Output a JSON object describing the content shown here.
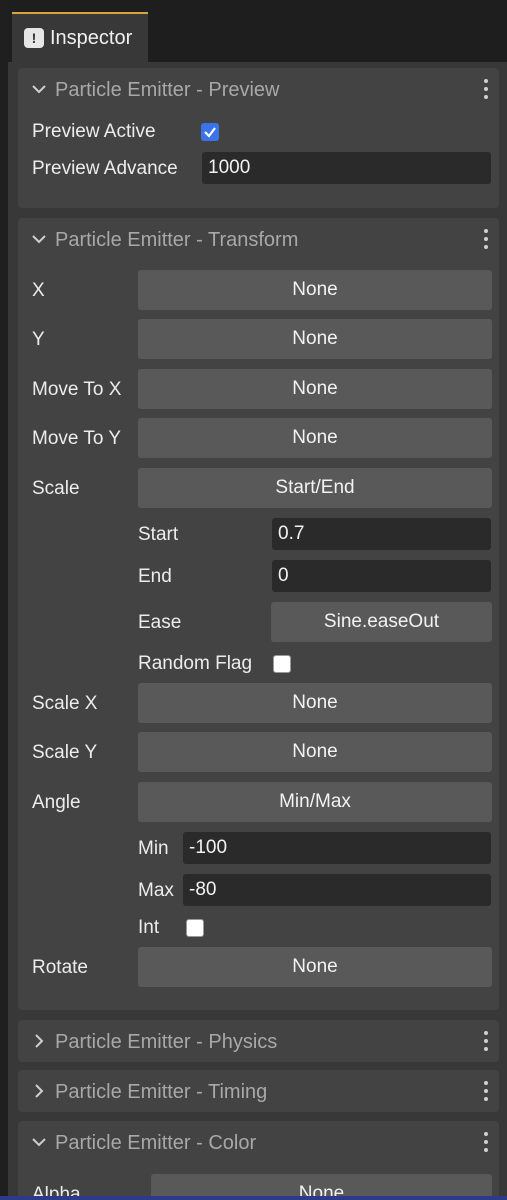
{
  "tab": {
    "icon": "info-bubble-icon",
    "label": "Inspector"
  },
  "preview": {
    "title": "Particle Emitter - Preview",
    "active_label": "Preview Active",
    "active_checked": true,
    "advance_label": "Preview Advance",
    "advance_value": "1000"
  },
  "transform": {
    "title": "Particle Emitter - Transform",
    "x": {
      "label": "X",
      "value": "None"
    },
    "y": {
      "label": "Y",
      "value": "None"
    },
    "move_to_x": {
      "label": "Move To X",
      "value": "None"
    },
    "move_to_y": {
      "label": "Move To Y",
      "value": "None"
    },
    "scale": {
      "label": "Scale",
      "value": "Start/End",
      "start_label": "Start",
      "start_value": "0.7",
      "end_label": "End",
      "end_value": "0",
      "ease_label": "Ease",
      "ease_value": "Sine.easeOut",
      "random_label": "Random Flag",
      "random_checked": false
    },
    "scale_x": {
      "label": "Scale X",
      "value": "None"
    },
    "scale_y": {
      "label": "Scale Y",
      "value": "None"
    },
    "angle": {
      "label": "Angle",
      "value": "Min/Max",
      "min_label": "Min",
      "min_value": "-100",
      "max_label": "Max",
      "max_value": "-80",
      "int_label": "Int",
      "int_checked": false
    },
    "rotate": {
      "label": "Rotate",
      "value": "None"
    }
  },
  "physics": {
    "title": "Particle Emitter - Physics"
  },
  "timing": {
    "title": "Particle Emitter - Timing"
  },
  "color": {
    "title": "Particle Emitter - Color",
    "alpha": {
      "label": "Alpha",
      "value": "None"
    }
  },
  "colors": {
    "accent": "#3a74e8",
    "tab_highlight": "#d9a43a"
  }
}
